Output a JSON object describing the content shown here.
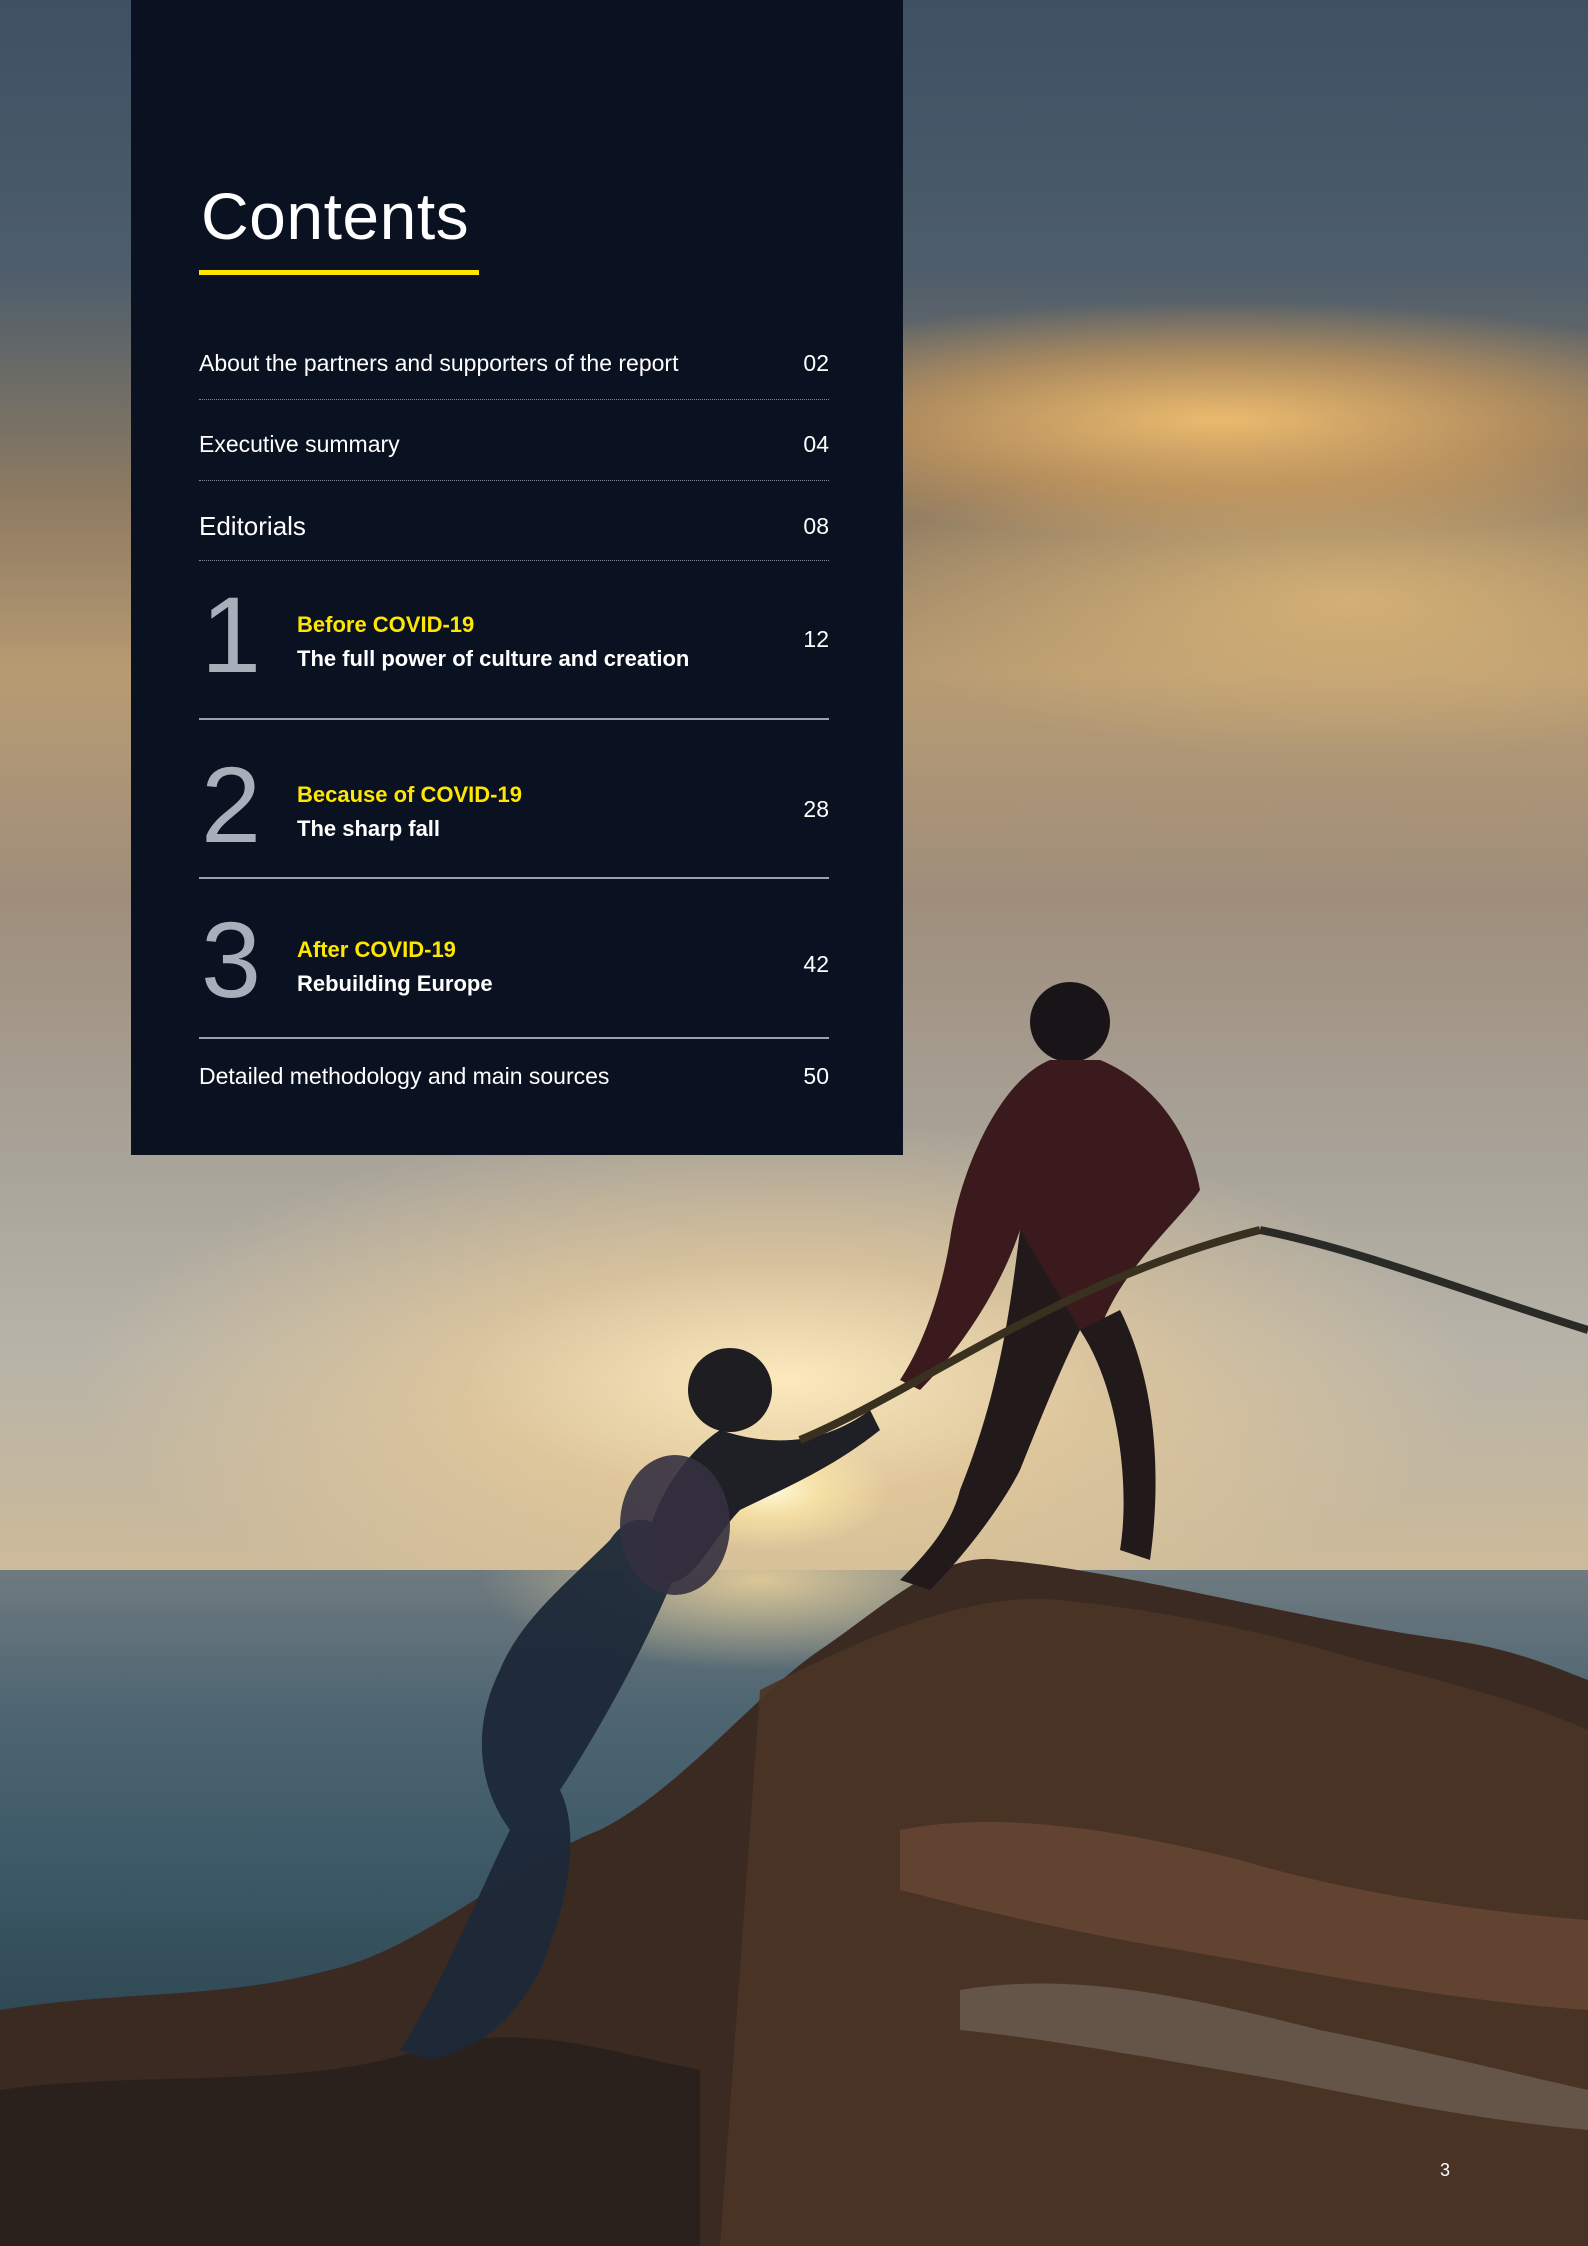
{
  "contents": {
    "title": "Contents",
    "rows": [
      {
        "label": "About the partners and supporters of the report",
        "page": "02"
      },
      {
        "label": "Executive summary",
        "page": "04"
      },
      {
        "label": "Editorials",
        "page": "08"
      }
    ],
    "chapters": [
      {
        "number": "1",
        "kicker": "Before COVID-19",
        "subtitle": "The full power of culture and creation",
        "page": "12"
      },
      {
        "number": "2",
        "kicker": "Because of COVID-19",
        "subtitle": "The sharp fall",
        "page": "28"
      },
      {
        "number": "3",
        "kicker": "After COVID-19",
        "subtitle": "Rebuilding Europe",
        "page": "42"
      }
    ],
    "footer_row": {
      "label": "Detailed methodology and main sources",
      "page": "50"
    }
  },
  "page_number": "3",
  "colors": {
    "panel": "#0a1120",
    "accent": "#ffe600",
    "chapter_number": "#a7b0ba"
  }
}
